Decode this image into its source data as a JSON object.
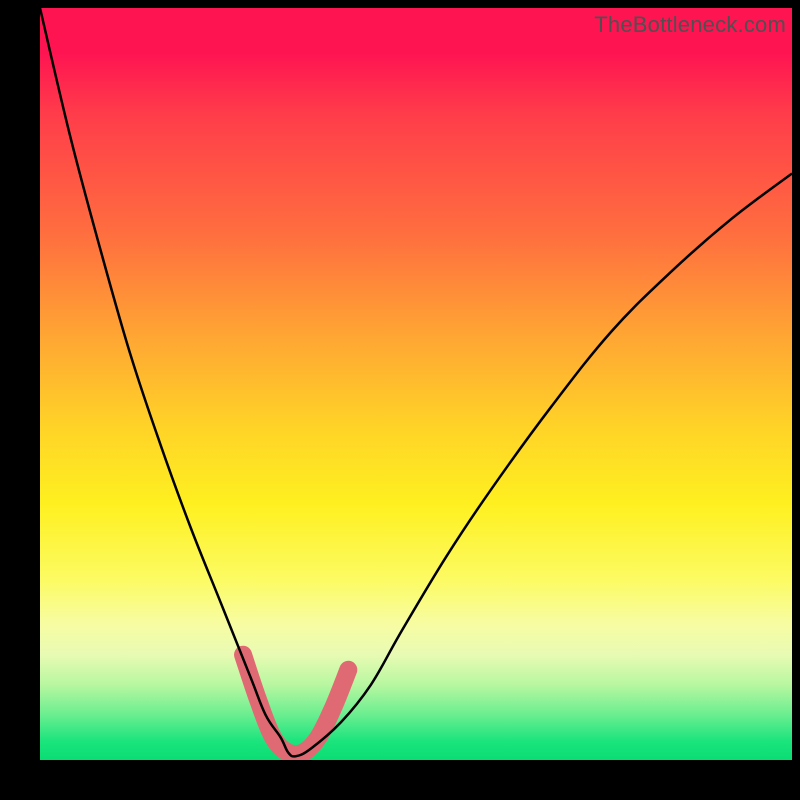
{
  "watermark": "TheBottleneck.com",
  "colors": {
    "black": "#000000",
    "curve": "#000000",
    "valley_marker": "#e06a73",
    "valley_marker_stroke_width": 18,
    "curve_stroke_width": 2.5
  },
  "chart_data": {
    "type": "line",
    "title": "",
    "xlabel": "",
    "ylabel": "",
    "xlim": [
      0,
      100
    ],
    "ylim": [
      0,
      100
    ],
    "grid": false,
    "legend": false,
    "annotations": [
      "TheBottleneck.com"
    ],
    "series": [
      {
        "name": "bottleneck-curve",
        "x": [
          0,
          4,
          8,
          12,
          16,
          20,
          24,
          28,
          30,
          32,
          33,
          34,
          36,
          40,
          44,
          48,
          54,
          60,
          68,
          76,
          84,
          92,
          100
        ],
        "y": [
          100,
          83,
          68,
          54,
          42,
          31,
          21,
          11,
          6,
          3,
          1,
          0.5,
          1.5,
          5,
          10,
          17,
          27,
          36,
          47,
          57,
          65,
          72,
          78
        ]
      }
    ],
    "valley_marker": {
      "x": [
        27,
        29,
        31,
        33,
        35,
        37,
        39,
        41
      ],
      "y": [
        14,
        8,
        3,
        1,
        1,
        3,
        7,
        12
      ]
    }
  }
}
